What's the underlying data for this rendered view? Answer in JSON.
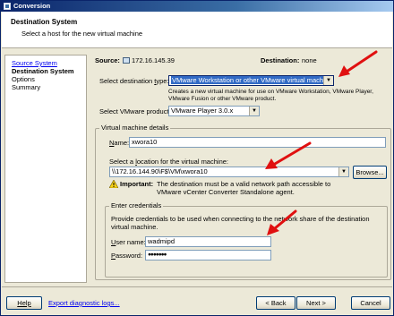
{
  "window": {
    "title": "Conversion"
  },
  "header": {
    "title": "Destination System",
    "subtitle": "Select a host for the new virtual machine"
  },
  "nav": {
    "items": [
      {
        "label": "Source System",
        "state": "link"
      },
      {
        "label": "Destination System",
        "state": "current"
      },
      {
        "label": "Options",
        "state": "normal"
      },
      {
        "label": "Summary",
        "state": "normal"
      }
    ]
  },
  "source": {
    "label": "Source:",
    "value": "172.16.145.39"
  },
  "destination": {
    "label": "Destination:",
    "value": "none"
  },
  "dest_type": {
    "label": "Select destination type:",
    "value": "VMware Workstation or other VMware virtual machine",
    "description": "Creates a new virtual machine for use on VMware Workstation, VMware Player, VMware Fusion or other VMware product."
  },
  "product": {
    "label": "Select VMware product:",
    "value": "VMware Player 3.0.x"
  },
  "vm_details": {
    "legend": "Virtual machine details",
    "name_label": "Name:",
    "name_value": "xwora10",
    "location_label": "Select a location for the virtual machine:",
    "location_value": "\\\\172.16.144.90\\F$\\VM\\xwora10",
    "browse_label": "Browse...",
    "important_label": "Important:",
    "important_text": "The destination must be a valid network path accessible to VMware vCenter Converter Standalone agent."
  },
  "credentials": {
    "legend": "Enter credentials",
    "description": "Provide credentials to be used when connecting to the network share of the destination virtual machine.",
    "username_label": "User name:",
    "username_value": "wadmipd",
    "password_label": "Password:",
    "password_value": "●●●●●●●"
  },
  "footer": {
    "help_label": "Help",
    "export_label": "Export diagnostic logs...",
    "back_label": "< Back",
    "next_label": "Next >",
    "cancel_label": "Cancel"
  },
  "colors": {
    "annotation_arrow": "#e01010",
    "link": "#0000ee",
    "selection": "#316ac5"
  }
}
